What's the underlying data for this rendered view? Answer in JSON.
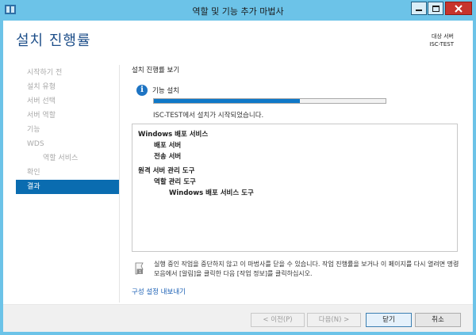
{
  "window": {
    "title": "역할 및 기능 추가 마법사"
  },
  "header": {
    "title": "설치 진행률",
    "target_label": "대상 서버",
    "target_server": "ISC-TEST"
  },
  "nav": {
    "items": [
      {
        "label": "시작하기 전",
        "state": "disabled",
        "indent": 0
      },
      {
        "label": "설치 유형",
        "state": "disabled",
        "indent": 0
      },
      {
        "label": "서버 선택",
        "state": "disabled",
        "indent": 0
      },
      {
        "label": "서버 역할",
        "state": "disabled",
        "indent": 0
      },
      {
        "label": "기능",
        "state": "disabled",
        "indent": 0
      },
      {
        "label": "WDS",
        "state": "disabled",
        "indent": 0
      },
      {
        "label": "역할 서비스",
        "state": "disabled",
        "indent": 1
      },
      {
        "label": "확인",
        "state": "disabled",
        "indent": 0
      },
      {
        "label": "결과",
        "state": "active",
        "indent": 0
      }
    ]
  },
  "main": {
    "section_title": "설치 진행률 보기",
    "status_label": "기능 설치",
    "progress_fraction": 0.63,
    "status_message": "ISC-TEST에서 설치가 시작되었습니다.",
    "results": [
      {
        "text": "Windows 배포 서비스",
        "level": 0
      },
      {
        "text": "배포 서버",
        "level": 1
      },
      {
        "text": "전송 서버",
        "level": 1
      },
      {
        "text": "원격 서버 관리 도구",
        "level": 0
      },
      {
        "text": "역할 관리 도구",
        "level": 1
      },
      {
        "text": "Windows 배포 서비스 도구",
        "level": 2
      }
    ],
    "notice": "실행 중인 작업을 중단하지 않고 이 마법사를 닫을 수 있습니다. 작업 진행률을 보거나 이 페이지를 다시 열려면 명령 모음에서 [알림]을 클릭한 다음 [작업 정보]를 클릭하십시오.",
    "export_link": "구성 설정 내보내기"
  },
  "footer": {
    "prev_label": "< 이전(P)",
    "next_label": "다음(N) >",
    "close_label": "닫기",
    "cancel_label": "취소"
  },
  "colors": {
    "titlebar": "#6cc3e8",
    "accent": "#0a6cb0",
    "progress": "#0f78c8",
    "link": "#1a5fb4"
  }
}
